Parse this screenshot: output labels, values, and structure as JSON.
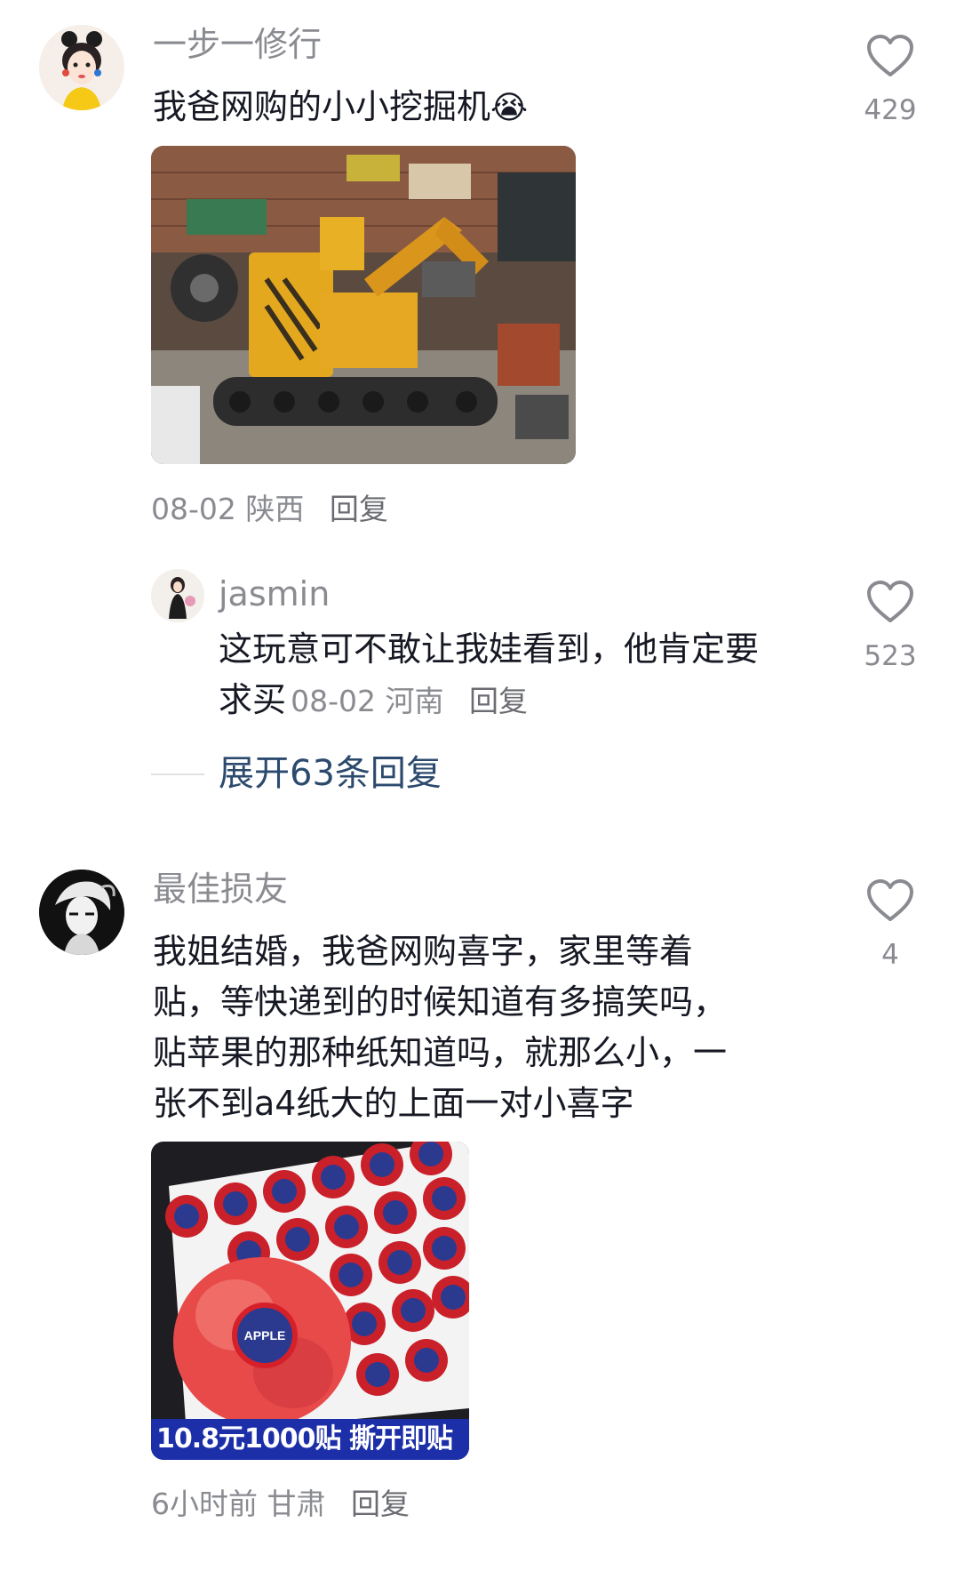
{
  "comments": [
    {
      "username": "一步一修行",
      "text": "我爸网购的小小挖掘机",
      "emoji": "😭",
      "date": "08-02",
      "location": "陕西",
      "reply_label": "回复",
      "likes": "429",
      "replies": [
        {
          "username": "jasmin",
          "text_line1": "这玩意可不敢让我娃看到，他肯定要",
          "text_line2": "求买",
          "date": "08-02",
          "location": "河南",
          "reply_label": "回复",
          "likes": "523"
        }
      ],
      "expand_label": "展开63条回复"
    },
    {
      "username": "最佳损友",
      "text_lines": [
        "我姐结婚，我爸网购喜字，家里等着",
        "贴，等快递到的时候知道有多搞笑吗，",
        "贴苹果的那种纸知道吗，就那么小，一",
        "张不到a4纸大的上面一对小喜字"
      ],
      "image_banner": "10.8元1000贴 撕开即贴",
      "sticker_text": "APPLE",
      "time": "6小时前",
      "location": "甘肃",
      "reply_label": "回复",
      "likes": "4"
    }
  ],
  "icons": {
    "like": "heart-outline-icon"
  }
}
